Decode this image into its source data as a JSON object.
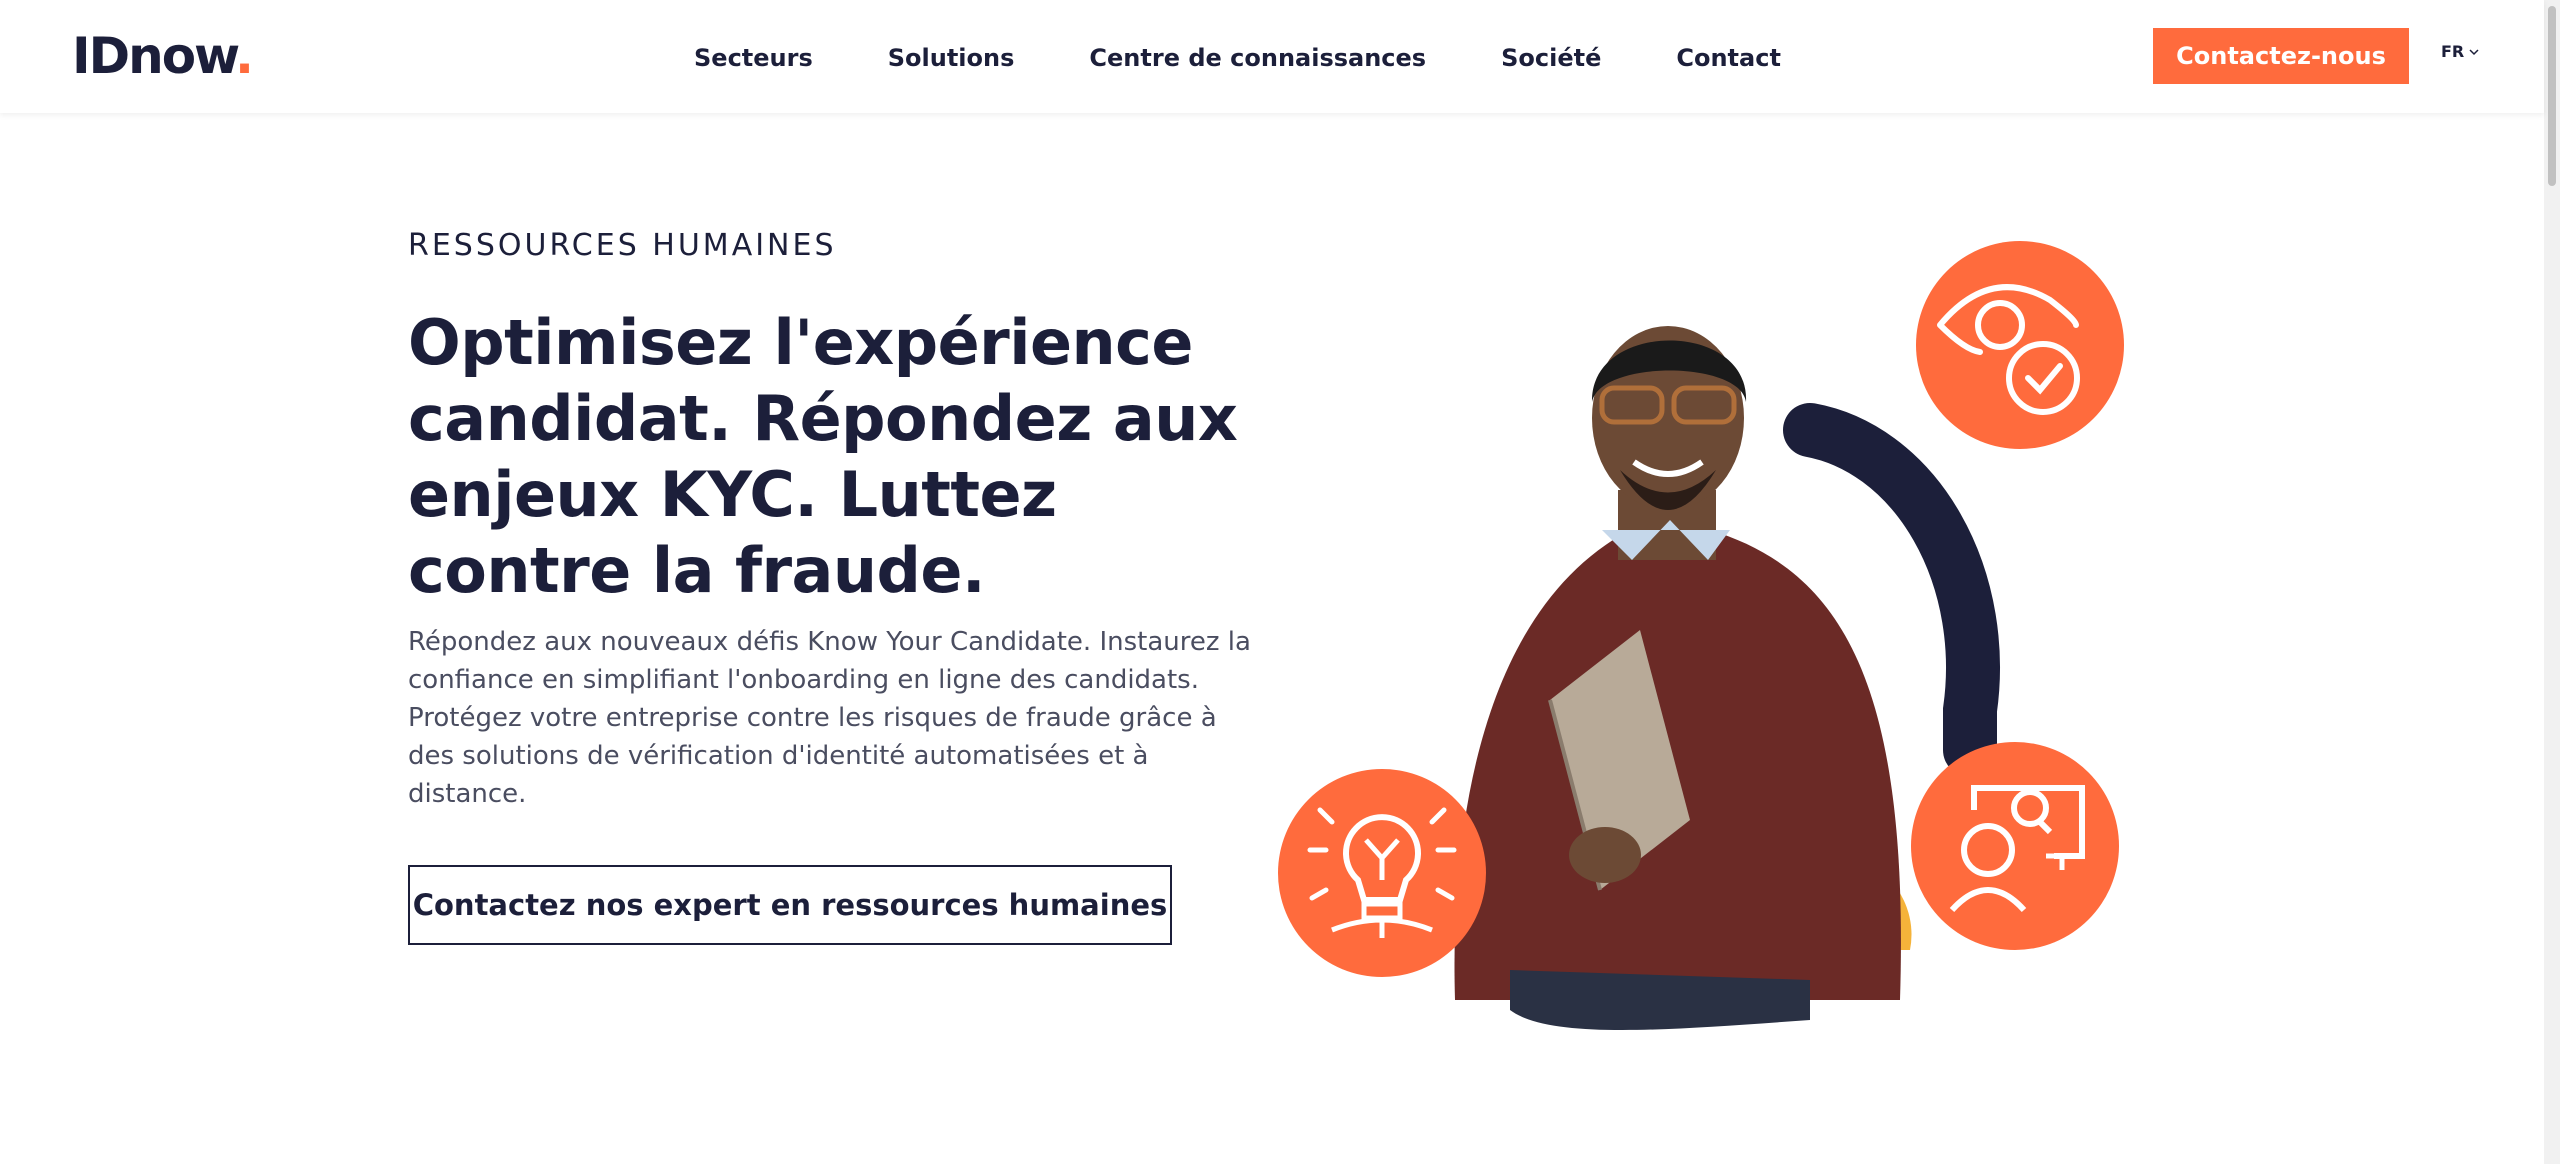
{
  "header": {
    "logo_text": "IDnow",
    "logo_dot": ".",
    "nav": [
      {
        "label": "Secteurs"
      },
      {
        "label": "Solutions"
      },
      {
        "label": "Centre de connaissances"
      },
      {
        "label": "Société"
      },
      {
        "label": "Contact"
      }
    ],
    "cta_label": "Contactez-nous",
    "lang": "FR"
  },
  "hero": {
    "eyebrow": "RESSOURCES HUMAINES",
    "headline": "Optimisez l'expérience candidat. Répondez aux enjeux KYC. Luttez contre la fraude.",
    "description": "Répondez aux nouveaux défis Know Your Candidate. Instaurez la confiance en simplifiant l'onboarding en ligne des candidats. Protégez votre entreprise contre les risques de fraude grâce à des solutions de vérification d'identité automatisées et à distance.",
    "button_label": "Contactez nos expert en ressources humaines"
  },
  "illustration": {
    "icons": [
      "eye-check-icon",
      "lightbulb-icon",
      "user-search-icon"
    ]
  },
  "colors": {
    "brand_orange": "#ff6b3d",
    "navy": "#1c1f3a",
    "yellow": "#f5b33a"
  }
}
